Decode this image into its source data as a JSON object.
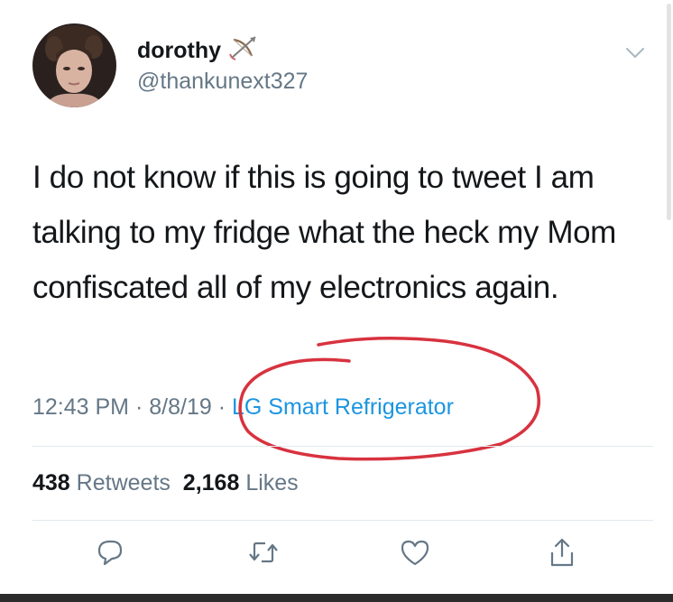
{
  "tweet": {
    "display_name": "dorothy",
    "handle": "@thankunext327",
    "text": "I do not know if this is going to tweet I am talking to my fridge what the heck my Mom confiscated all of my electronics again.",
    "time": "12:43 PM",
    "separator1": "·",
    "date": "8/8/19",
    "separator2": "·",
    "source": "LG Smart Refrigerator"
  },
  "stats": {
    "retweets_count": "438",
    "retweets_label": "Retweets",
    "likes_count": "2,168",
    "likes_label": "Likes"
  },
  "icons": {
    "name_emoji": "bow-and-arrow-icon",
    "menu": "chevron-down-icon",
    "reply": "reply-icon",
    "retweet": "retweet-icon",
    "like": "heart-icon",
    "share": "share-icon"
  },
  "colors": {
    "link_blue": "#1b95e0",
    "secondary_text": "#657786",
    "annotation_red": "#d8323f"
  }
}
